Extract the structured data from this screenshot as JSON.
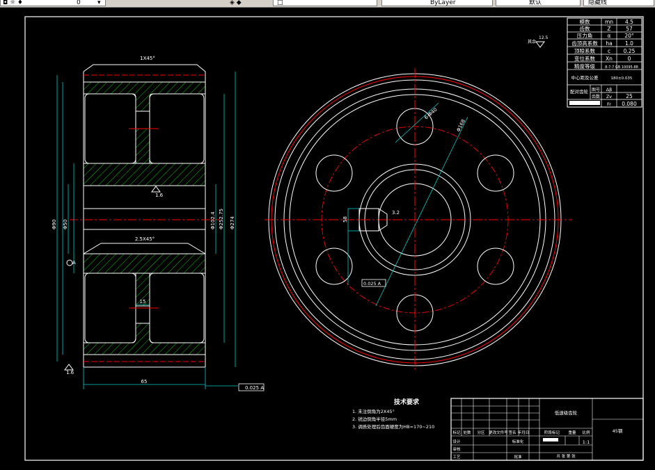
{
  "toolbar": {
    "layer_value": "0",
    "color_value": "ByLayer",
    "linetype_value": "默认",
    "extra_value": "隐藏线"
  },
  "parameters_table": {
    "rows": [
      {
        "label": "模数",
        "symbol": "mn",
        "value": "4.5"
      },
      {
        "label": "齿数",
        "symbol": "Z",
        "value": "57"
      },
      {
        "label": "压力角",
        "symbol": "α",
        "value": "20°"
      },
      {
        "label": "齿顶高系数",
        "symbol": "ha",
        "value": "1.0"
      },
      {
        "label": "顶隙系数",
        "symbol": "c",
        "value": "0.25"
      },
      {
        "label": "变位系数",
        "symbol": "Xn",
        "value": "0"
      },
      {
        "label": "精度等级",
        "symbol": "",
        "value": "8-7-7 GB 10095-88"
      },
      {
        "label": "中心距及公差",
        "symbol": "",
        "value": "180±0.035"
      }
    ],
    "paired_label": "配对齿轮",
    "paired_rows": [
      {
        "sub": "图号",
        "symbol": "Δβ",
        "value": ""
      },
      {
        "sub": "齿数",
        "symbol": "Zv",
        "value": "25"
      },
      {
        "sub": "",
        "symbol": "Fr",
        "value": "0.080"
      }
    ]
  },
  "roughness_note": "其余",
  "roughness_value": "12.5",
  "dimensions": {
    "top_chamfer": "1X45°",
    "inner_chamfer": "2.5X45°",
    "width": "65",
    "key_width": "15",
    "root_dia": "Φ252.75",
    "tip_dia": "Φ274",
    "pitch_dia": "Φ102.4",
    "bore": "Φ50",
    "hub": "Φ90",
    "keyway": "58",
    "roughness_a": "1.6",
    "roughness_b": "1.6",
    "roughness_c": "3.2",
    "tol_frame": "0.025 A",
    "tol_frame2": "0.025 A",
    "datum": "A",
    "hole_dia": "6-Φ40",
    "pcd": "Φ168"
  },
  "tech_req": {
    "title": "技术要求",
    "items": [
      "1. 未注倒角为2X45°",
      "2. 锐边倒角半径5mm",
      "3. 调质处理后齿面硬度为HB=170~210"
    ]
  },
  "title_block": {
    "part_name": "低速级齿轮",
    "material": "45钢",
    "scale": "1:1",
    "drawing_note": "共 张 第 张",
    "row_labels": [
      "标记",
      "设计",
      "审核",
      "工艺"
    ],
    "header_cells": [
      "处数",
      "分区",
      "更改文件号",
      "签名",
      "年月日"
    ],
    "std_label": "标准化",
    "approve_label": "批准",
    "stage_labels": [
      "阶段标记",
      "重量",
      "比例"
    ]
  }
}
